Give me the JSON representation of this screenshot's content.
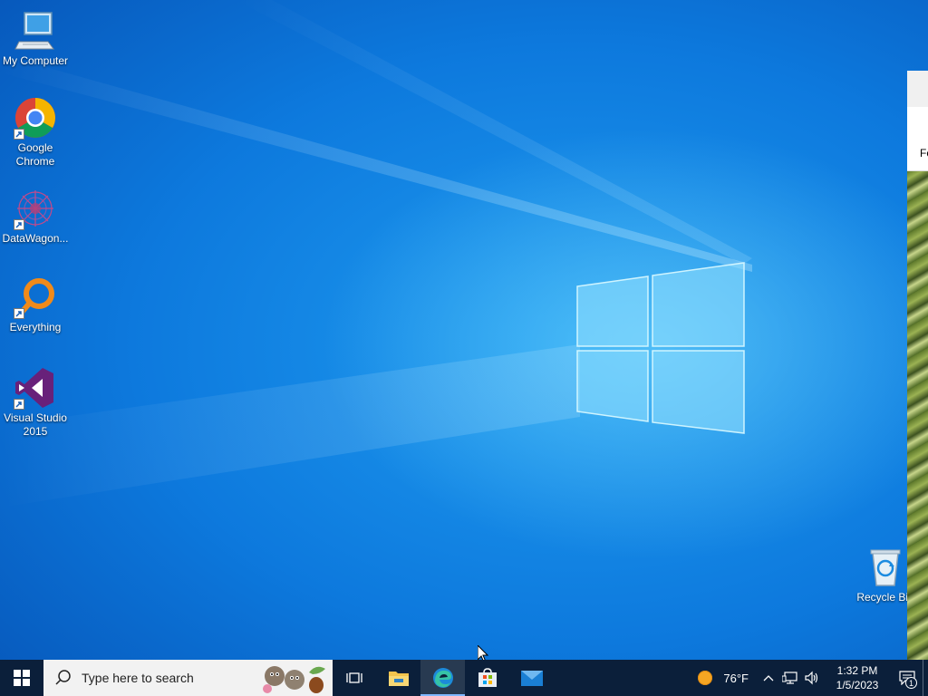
{
  "desktop_icons": [
    {
      "label": "My Computer",
      "icon": "computer-icon"
    },
    {
      "label": "Google Chrome",
      "icon": "chrome-icon"
    },
    {
      "label": "DataWagon...",
      "icon": "datawagon-icon"
    },
    {
      "label": "Everything",
      "icon": "everything-icon"
    },
    {
      "label": "Visual Studio 2015",
      "icon": "visual-studio-icon"
    },
    {
      "label": "Recycle Bin",
      "icon": "recycle-bin-icon"
    }
  ],
  "side_window": {
    "toolbar_text": "Fo"
  },
  "taskbar": {
    "search_placeholder": "Type here to search",
    "apps": [
      {
        "name": "task-view",
        "icon": "task-view-icon"
      },
      {
        "name": "file-explorer",
        "icon": "folder-icon"
      },
      {
        "name": "edge",
        "icon": "edge-icon",
        "active": true
      },
      {
        "name": "store",
        "icon": "store-icon"
      },
      {
        "name": "mail",
        "icon": "mail-icon"
      }
    ],
    "weather": {
      "temp": "76°F",
      "icon": "sun-icon"
    },
    "clock": {
      "time": "1:32 PM",
      "date": "1/5/2023"
    },
    "notifications": {
      "count": "1"
    }
  },
  "colors": {
    "taskbar": "#0b1f3a",
    "desktop": "#0a6fd6",
    "accent": "#7fb7ff"
  }
}
